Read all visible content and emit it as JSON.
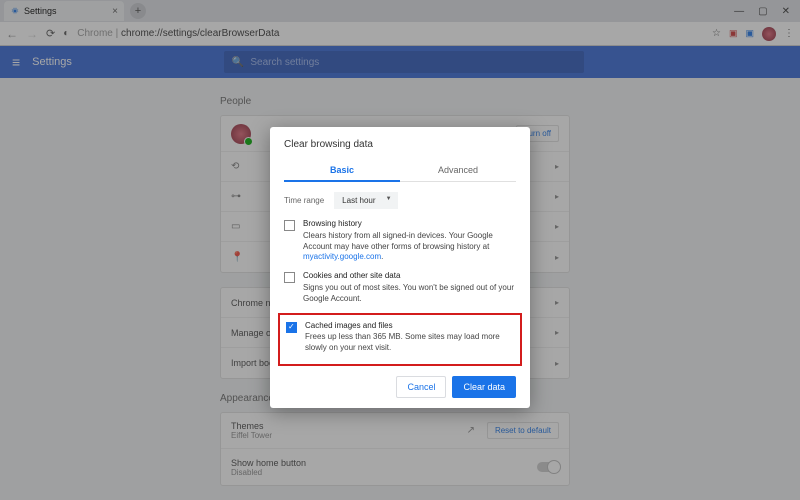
{
  "browser": {
    "tab_title": "Settings",
    "url_scheme": "Chrome",
    "url_path": "chrome://settings/clearBrowserData",
    "win": {
      "min": "—",
      "max": "▢",
      "close": "✕"
    }
  },
  "header": {
    "title": "Settings",
    "search_placeholder": "Search settings"
  },
  "sections": {
    "people": "People",
    "appearance": "Appearance"
  },
  "people": {
    "turn_off": "Turn off",
    "rows": {
      "chrome_name": "Chrome name",
      "manage_other": "Manage other",
      "import_bookmarks": "Import bookmarks"
    }
  },
  "appearance": {
    "themes": "Themes",
    "themes_sub": "Eiffel Tower",
    "reset": "Reset to default",
    "home_btn": "Show home button",
    "home_sub": "Disabled"
  },
  "dialog": {
    "title": "Clear browsing data",
    "tabs": {
      "basic": "Basic",
      "advanced": "Advanced"
    },
    "time_range_label": "Time range",
    "time_range_value": "Last hour",
    "opts": {
      "history": {
        "title": "Browsing history",
        "desc": "Clears history from all signed-in devices. Your Google Account may have other forms of browsing history at ",
        "link": "myactivity.google.com"
      },
      "cookies": {
        "title": "Cookies and other site data",
        "desc": "Signs you out of most sites. You won't be signed out of your Google Account."
      },
      "cache": {
        "title": "Cached images and files",
        "desc": "Frees up less than 365 MB. Some sites may load more slowly on your next visit."
      }
    },
    "cancel": "Cancel",
    "clear": "Clear data"
  }
}
